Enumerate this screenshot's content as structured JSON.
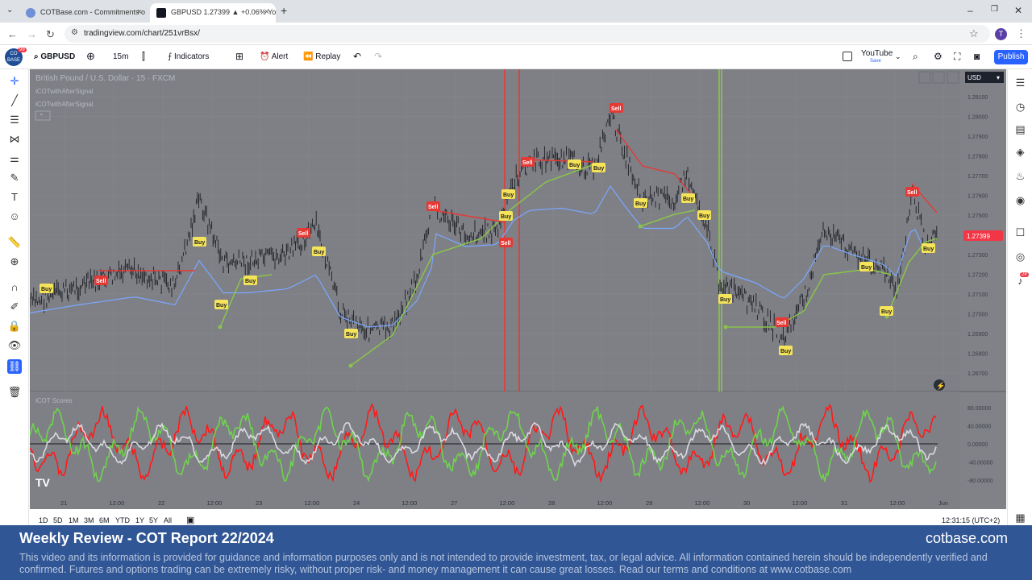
{
  "browser": {
    "tabs": [
      {
        "title": "COTBase.com - Commitments o",
        "active": false
      },
      {
        "title": "GBPUSD 1.27399 ▲ +0.06% Yo",
        "active": true
      }
    ],
    "new_tab": "+",
    "url": "tradingview.com/chart/251vrBsx/",
    "profile_initial": "T"
  },
  "toolbar": {
    "logo": "CO BASE",
    "logo_badge": "99",
    "symbol": "GBPUSD",
    "interval": "15m",
    "indicators": "Indicators",
    "alert": "Alert",
    "replay": "Replay",
    "layout_name": "YouTube",
    "layout_status": "Save",
    "publish": "Publish"
  },
  "chart": {
    "instrument_title": "British Pound / U.S. Dollar · 15 · FXCM",
    "indicator_1": "iCOTwithAfterSignal",
    "indicator_2": "iCOTwithAfterSignal",
    "currency": "USD",
    "current_price": "1.27399",
    "price_ticks": [
      "1.28100",
      "1.28000",
      "1.27900",
      "1.27800",
      "1.27700",
      "1.27600",
      "1.27500",
      "1.27400",
      "1.27300",
      "1.27200",
      "1.27100",
      "1.27000",
      "1.26900",
      "1.26800",
      "1.26700"
    ],
    "sub_pane_title": "iCOT Scores",
    "score_ticks": [
      "80.00000",
      "40.00000",
      "0.00000",
      "-40.00000",
      "-80.00000"
    ],
    "time_ticks": [
      "21",
      "12:00",
      "22",
      "12:00",
      "23",
      "12:00",
      "24",
      "12:00",
      "27",
      "12:00",
      "28",
      "12:00",
      "29",
      "12:00",
      "30",
      "12:00",
      "31",
      "12:00",
      "Jun"
    ],
    "signals": [
      {
        "label": "Buy",
        "type": "buy"
      },
      {
        "label": "Sell",
        "type": "sell"
      },
      {
        "label": "Buy",
        "type": "buy"
      },
      {
        "label": "Buy",
        "type": "buy"
      },
      {
        "label": "Buy",
        "type": "buy"
      },
      {
        "label": "Sell",
        "type": "sell"
      },
      {
        "label": "Buy",
        "type": "buy"
      },
      {
        "label": "Buy",
        "type": "buy"
      },
      {
        "label": "Sell",
        "type": "sell"
      },
      {
        "label": "Buy",
        "type": "buy"
      },
      {
        "label": "Sell",
        "type": "sell"
      },
      {
        "label": "Buy",
        "type": "buy"
      },
      {
        "label": "Sell",
        "type": "sell"
      },
      {
        "label": "Buy",
        "type": "buy"
      },
      {
        "label": "Buy",
        "type": "buy"
      },
      {
        "label": "Sell",
        "type": "sell"
      },
      {
        "label": "Buy",
        "type": "buy"
      },
      {
        "label": "Buy",
        "type": "buy"
      },
      {
        "label": "Buy",
        "type": "buy"
      },
      {
        "label": "Buy",
        "type": "buy"
      },
      {
        "label": "Sell",
        "type": "sell"
      },
      {
        "label": "Buy",
        "type": "buy"
      },
      {
        "label": "Buy",
        "type": "buy"
      },
      {
        "label": "Buy",
        "type": "buy"
      },
      {
        "label": "Sell",
        "type": "sell"
      },
      {
        "label": "Buy",
        "type": "buy"
      }
    ]
  },
  "range": {
    "buttons": [
      "1D",
      "5D",
      "1M",
      "3M",
      "6M",
      "YTD",
      "1Y",
      "5Y",
      "All"
    ],
    "clock": "12:31:15 (UTC+2)"
  },
  "notification_badge": "28",
  "banner": {
    "title": "Weekly Review - COT Report 22/2024",
    "site": "cotbase.com",
    "disclaimer": "This video and its information is provided for guidance and information purposes only and is not intended to provide investment, tax, or legal advice. All information contained herein should be independently verified and confirmed. Futures and options trading can be extremely risky, without proper risk- and money management it can cause great losses. Read our terms and conditions at www.cotbase.com"
  },
  "colors": {
    "chart_bg": "#7e8086",
    "sell_red": "#e53935",
    "buy_green": "#8bc34a",
    "buy_label": "#f5e35a",
    "price_badge": "#f23645",
    "ma_blue": "#7ba7ff",
    "accent": "#2962ff"
  }
}
